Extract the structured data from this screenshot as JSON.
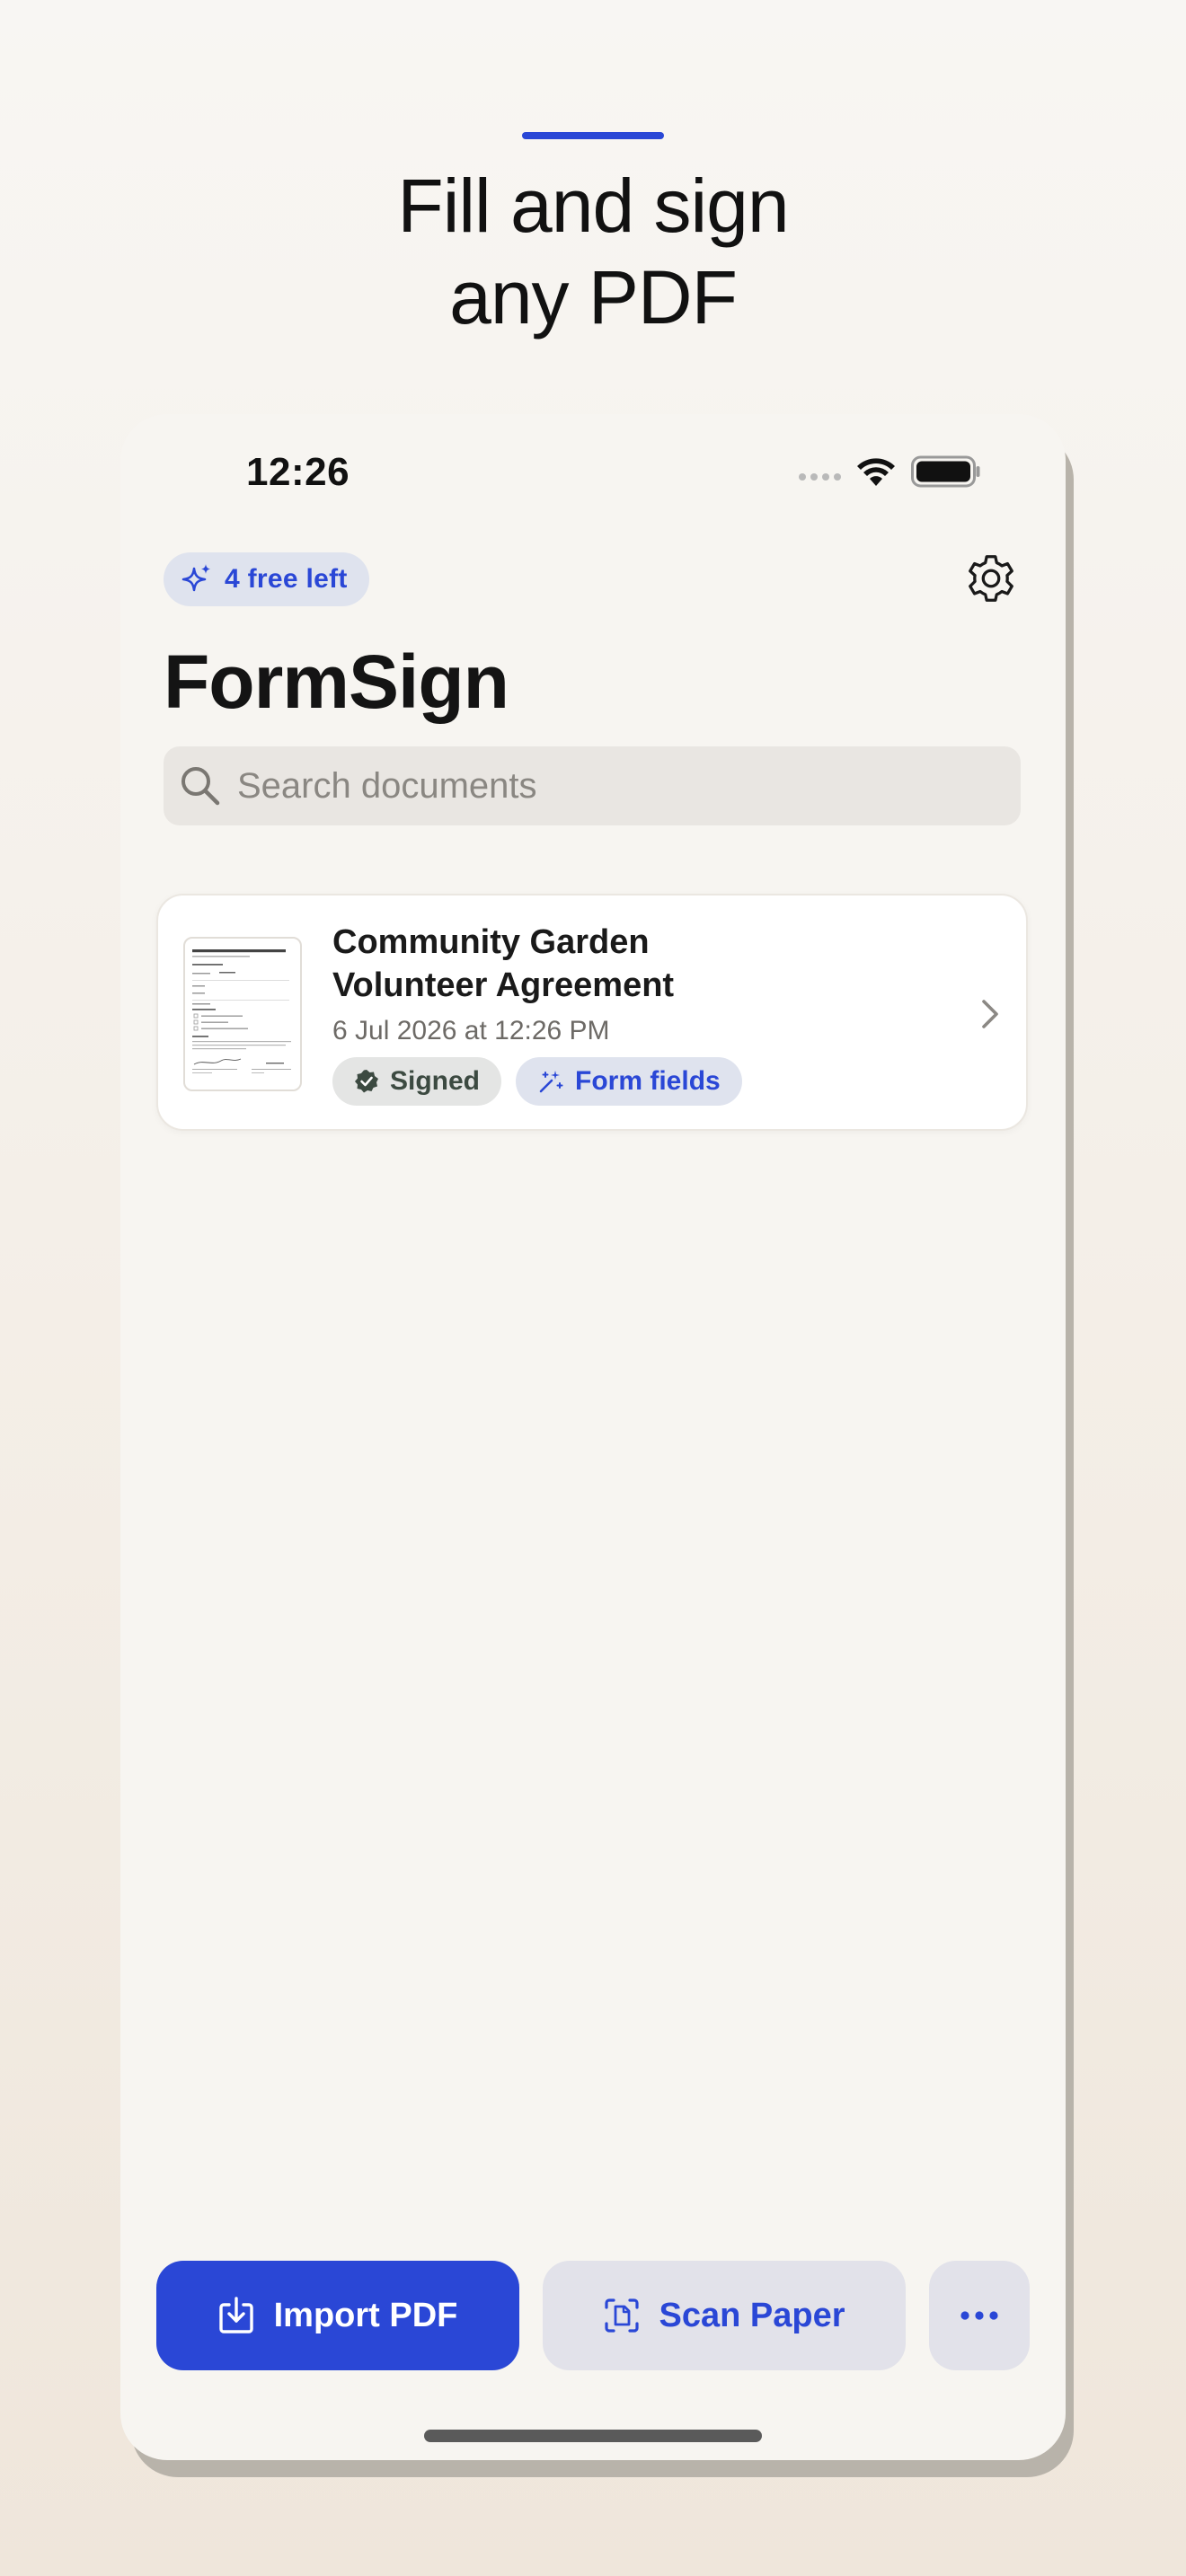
{
  "hero": {
    "title_line1": "Fill and sign",
    "title_line2": "any PDF"
  },
  "status_bar": {
    "time": "12:26"
  },
  "header": {
    "free_badge": "4 free left",
    "app_title": "FormSign"
  },
  "search": {
    "placeholder": "Search documents"
  },
  "documents": [
    {
      "title_line1": "Community Garden",
      "title_line2": "Volunteer Agreement",
      "date": "6 Jul 2026 at 12:26 PM",
      "tags": [
        "Signed",
        "Form fields"
      ],
      "thumbnail_heading": "Community Garden Volunteer Agreement"
    }
  ],
  "actions": {
    "import_label": "Import PDF",
    "scan_label": "Scan Paper",
    "more_label": "More"
  },
  "colors": {
    "accent": "#2a47d6",
    "signed_check": "#3c4a41",
    "background": "#f7f5f1"
  }
}
